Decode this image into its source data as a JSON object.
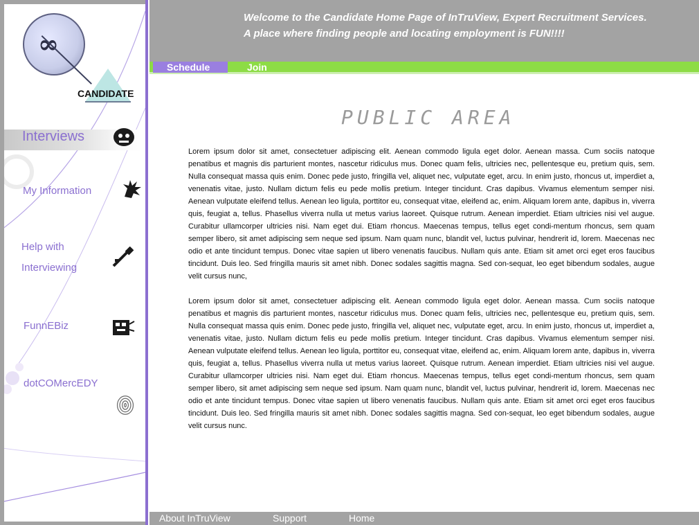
{
  "header": {
    "welcome_line": "Welcome to the Candidate Home Page of InTruView, Expert Recruitment Services.",
    "tagline_line": "A place where finding people and locating employment is FUN!!!!"
  },
  "logo": {
    "word": "CANDIDATE"
  },
  "sidebar": {
    "items": [
      {
        "label": "Interviews",
        "icon": "interview-face-icon"
      },
      {
        "label": "My Information",
        "icon": "spiky-creature-icon"
      },
      {
        "label_line1": "Help with",
        "label_line2": "Interviewing",
        "icon": "tool-icon"
      },
      {
        "label": "FunnEBiz",
        "icon": "biz-gadget-icon"
      },
      {
        "label": "dotCOMercEDY",
        "icon": "fingerprint-icon"
      }
    ]
  },
  "menu": {
    "items": [
      {
        "label": "Schedule",
        "active": true
      },
      {
        "label": "Join",
        "active": false
      }
    ]
  },
  "main": {
    "title": "PUBLIC AREA",
    "paragraphs": [
      "Lorem ipsum dolor sit amet, consectetuer adipiscing elit. Aenean commodo ligula eget dolor. Aenean massa. Cum sociis natoque penatibus et magnis dis parturient montes, nascetur ridiculus mus. Donec quam felis, ultricies nec, pellentesque eu, pretium quis, sem. Nulla consequat massa quis enim. Donec pede justo, fringilla vel, aliquet nec, vulputate eget, arcu. In enim justo, rhoncus ut, imperdiet a, venenatis vitae, justo. Nullam dictum felis eu pede mollis pretium. Integer tincidunt. Cras dapibus. Vivamus elementum semper nisi. Aenean vulputate eleifend tellus. Aenean leo ligula, porttitor eu, consequat vitae, eleifend ac, enim. Aliquam lorem ante, dapibus in, viverra quis, feugiat a, tellus. Phasellus viverra nulla ut metus varius laoreet. Quisque rutrum. Aenean imperdiet. Etiam ultricies nisi vel augue. Curabitur ullamcorper ultricies nisi. Nam eget dui. Etiam rhoncus. Maecenas tempus, tellus eget condi-mentum rhoncus, sem quam semper libero, sit amet adipiscing sem neque sed ipsum. Nam quam nunc, blandit vel, luctus pulvinar, hendrerit id, lorem. Maecenas nec odio et ante tincidunt tempus. Donec vitae sapien ut libero venenatis faucibus. Nullam quis ante. Etiam sit amet orci eget eros faucibus tincidunt. Duis leo. Sed fringilla mauris sit amet nibh. Donec sodales sagittis magna. Sed con-sequat, leo eget bibendum sodales, augue velit cursus nunc,",
      "Lorem ipsum dolor sit amet, consectetuer adipiscing elit. Aenean commodo ligula eget dolor. Aenean massa. Cum sociis natoque penatibus et magnis dis parturient montes, nascetur ridiculus mus. Donec quam felis, ultricies nec, pellentesque eu, pretium quis, sem. Nulla consequat massa quis enim. Donec pede justo, fringilla vel, aliquet nec, vulputate eget, arcu. In enim justo, rhoncus ut, imperdiet a, venenatis vitae, justo. Nullam dictum felis eu pede mollis pretium. Integer tincidunt. Cras dapibus. Vivamus elementum semper nisi. Aenean vulputate eleifend tellus. Aenean leo ligula, porttitor eu, consequat vitae, eleifend ac, enim. Aliquam lorem ante, dapibus in, viverra quis, feugiat a, tellus. Phasellus viverra nulla ut metus varius laoreet. Quisque rutrum. Aenean imperdiet. Etiam ultricies nisi vel augue. Curabitur ullamcorper ultricies nisi. Nam eget dui. Etiam rhoncus. Maecenas tempus, tellus eget condi-mentum rhoncus, sem quam semper libero, sit amet adipiscing sem neque sed ipsum. Nam quam nunc, blandit vel, luctus pulvinar, hendrerit id, lorem. Maecenas nec odio et ante tincidunt tempus. Donec vitae sapien ut libero venenatis faucibus. Nullam quis ante. Etiam sit amet orci eget eros faucibus tincidunt. Duis leo. Sed fringilla mauris sit amet nibh. Donec sodales sagittis magna. Sed con-sequat, leo eget bibendum sodales, augue velit cursus nunc."
    ]
  },
  "footer": {
    "links": [
      "About InTruView",
      "Support",
      "Home"
    ]
  },
  "colors": {
    "chrome_gray": "#a3a3a3",
    "accent_purple": "#8a6fd0",
    "menu_green": "#8ddc45",
    "active_tab": "#9a7fe0"
  }
}
